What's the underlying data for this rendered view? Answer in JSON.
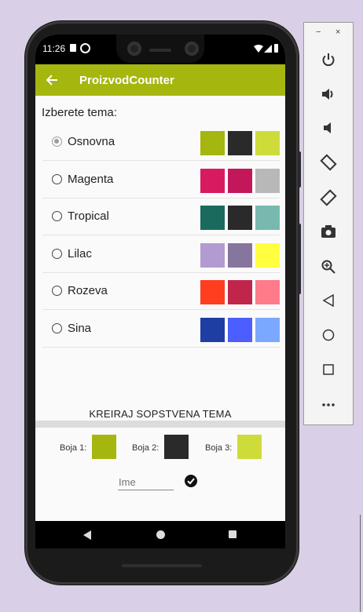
{
  "status": {
    "time": "11:26"
  },
  "app": {
    "title": "ProizvodCounter",
    "back_icon": "arrow-back-icon",
    "accent": "#a5b60f"
  },
  "choose_label": "Izberete tema:",
  "themes": [
    {
      "label": "Osnovna",
      "selected": true,
      "colors": [
        "#a5b60f",
        "#2a2a2a",
        "#cedc3a"
      ]
    },
    {
      "label": "Magenta",
      "selected": false,
      "colors": [
        "#d81b60",
        "#c2185b",
        "#b8b8b8"
      ]
    },
    {
      "label": "Tropical",
      "selected": false,
      "colors": [
        "#1a6b5d",
        "#2a2a2a",
        "#78b8ae"
      ]
    },
    {
      "label": "Lilac",
      "selected": false,
      "colors": [
        "#b39ad0",
        "#86769d",
        "#ffff40"
      ]
    },
    {
      "label": "Rozeva",
      "selected": false,
      "colors": [
        "#ff3d1f",
        "#c2254c",
        "#ff7a8a"
      ]
    },
    {
      "label": "Sina",
      "selected": false,
      "colors": [
        "#1f3ea3",
        "#4c5eff",
        "#7ba8ff"
      ]
    }
  ],
  "custom": {
    "title": "KREIRAJ SOPSTVENA TEMA",
    "color1_label": "Boja 1:",
    "color2_label": "Boja 2:",
    "color3_label": "Boja 3:",
    "colors": [
      "#a5b60f",
      "#2a2a2a",
      "#cedc3a"
    ],
    "name_placeholder": "Ime"
  },
  "panel": {
    "minimize": "−",
    "close": "×",
    "icons": [
      "power-icon",
      "volume-up-icon",
      "volume-down-icon",
      "rotate-left-icon",
      "rotate-right-icon",
      "camera-icon",
      "zoom-in-icon",
      "back-icon",
      "home-icon",
      "overview-icon",
      "more-icon"
    ]
  }
}
